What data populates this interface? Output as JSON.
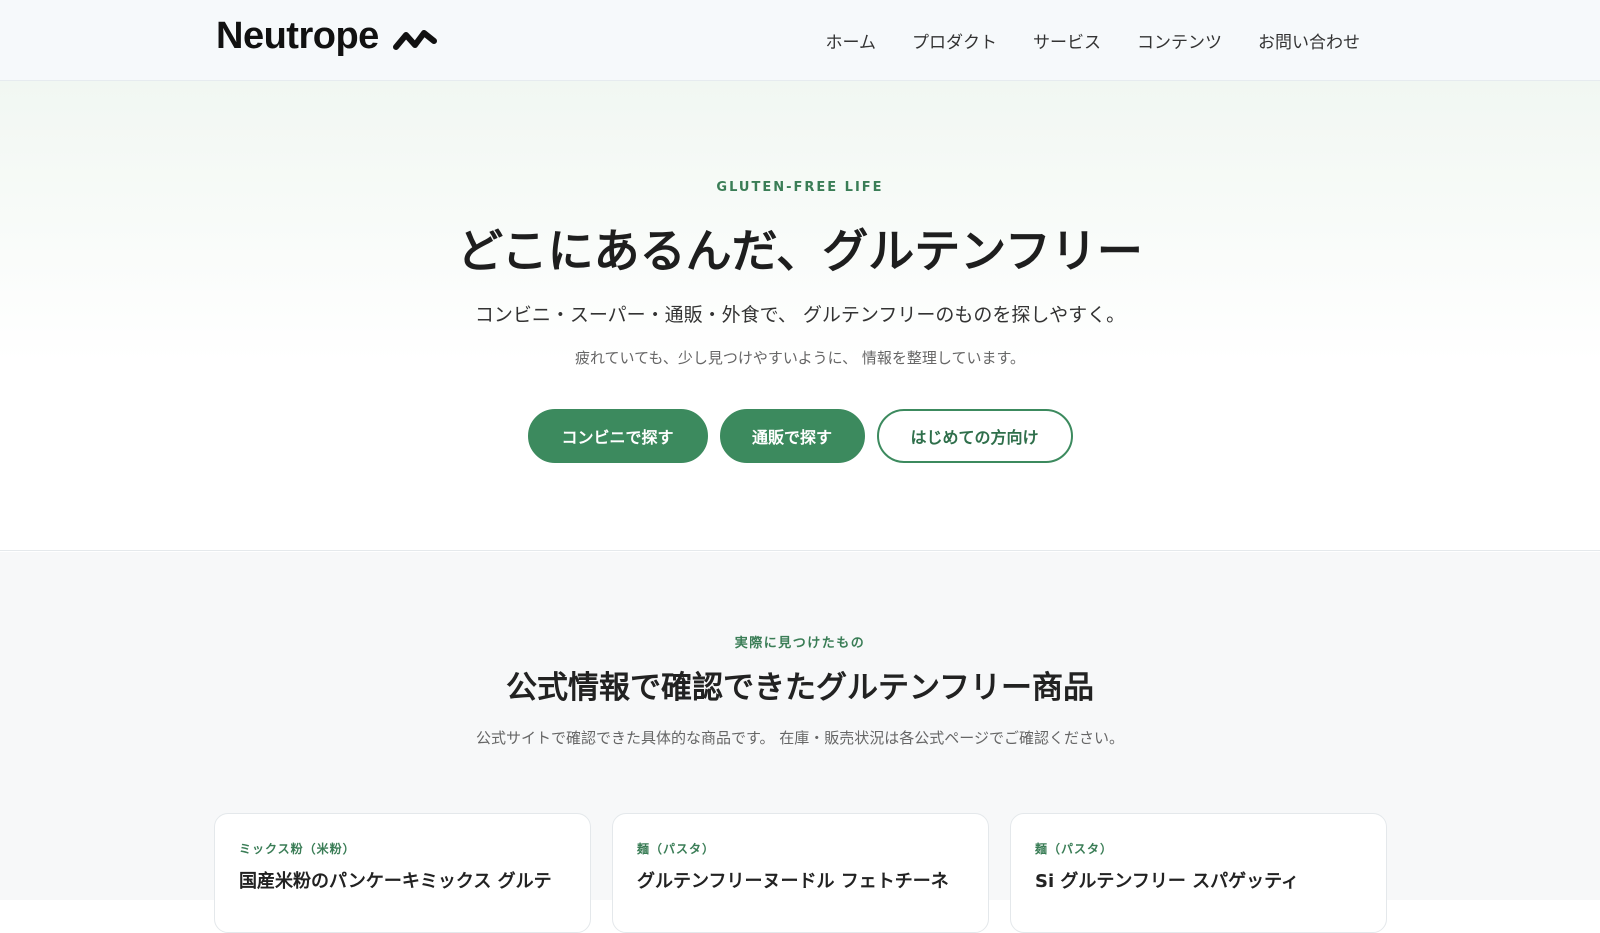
{
  "header": {
    "logo": "Neutrope",
    "nav": [
      "ホーム",
      "プロダクト",
      "サービス",
      "コンテンツ",
      "お問い合わせ"
    ]
  },
  "hero": {
    "eyebrow": "GLUTEN-FREE LIFE",
    "title": "どこにあるんだ、グルテンフリー",
    "lead": "コンビニ・スーパー・通販・外食で、 グルテンフリーのものを探しやすく。",
    "sub": "疲れていても、少し見つけやすいように、 情報を整理しています。",
    "buttons": [
      "コンビニで探す",
      "通販で探す",
      "はじめての方向け"
    ]
  },
  "products": {
    "eyebrow": "実際に見つけたもの",
    "title": "公式情報で確認できたグルテンフリー商品",
    "description": "公式サイトで確認できた具体的な商品です。 在庫・販売状況は各公式ページでご確認ください。",
    "cards": [
      {
        "tag": "ミックス粉（米粉）",
        "title": "国産米粉のパンケーキミックス グルテ"
      },
      {
        "tag": "麺（パスタ）",
        "title": "グルテンフリーヌードル フェトチーネ"
      },
      {
        "tag": "麺（パスタ）",
        "title": "Si グルテンフリー スパゲッティ"
      }
    ]
  },
  "colors": {
    "accent": "#3c8a5e",
    "accent_text": "#3a7d56"
  }
}
